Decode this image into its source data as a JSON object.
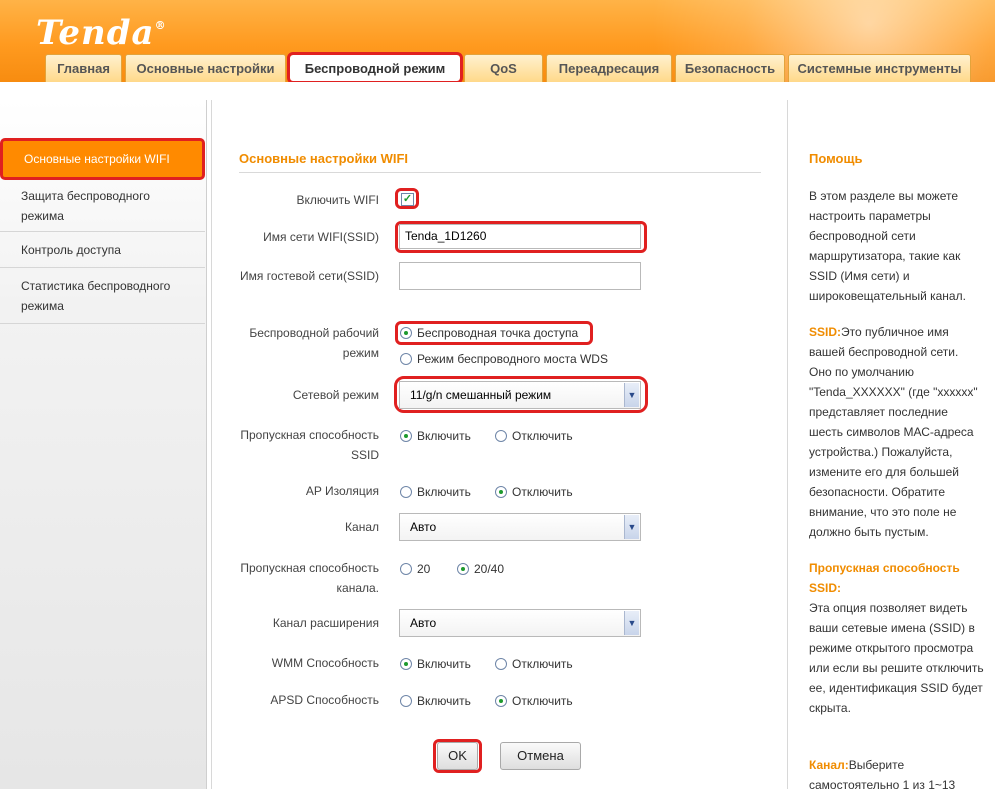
{
  "brand": {
    "logo_text": "Tenda",
    "reg_mark": "®"
  },
  "tabs": [
    {
      "label": "Главная"
    },
    {
      "label": "Основные настройки"
    },
    {
      "label": "Беспроводной режим"
    },
    {
      "label": "QoS"
    },
    {
      "label": "Переадресация"
    },
    {
      "label": "Безопасность"
    },
    {
      "label": "Системные инструменты"
    }
  ],
  "sidebar": {
    "items": [
      {
        "label": "Основные настройки WIFI"
      },
      {
        "label": "Защита беспроводного режима"
      },
      {
        "label": "Контроль доступа"
      },
      {
        "label": "Статистика беспроводного режима"
      }
    ]
  },
  "form": {
    "title": "Основные настройки WIFI",
    "enable_wifi_label": "Включить WIFI",
    "ssid_label": "Имя сети WIFI(SSID)",
    "ssid_value": "Tenda_1D1260",
    "guest_label": "Имя гостевой сети(SSID)",
    "guest_value": "",
    "mode_label": "Беспроводной рабочий режим",
    "mode_option_ap": "Беспроводная точка доступа",
    "mode_option_wds": "Режим беспроводного моста WDS",
    "net_mode_label": "Сетевой режим",
    "net_mode_value": "11/g/n смешанный режим",
    "ssid_broadcast_label": "Пропускная способность SSID",
    "ap_isolation_label": "AP Изоляция",
    "channel_label": "Канал",
    "channel_value": "Авто",
    "bandwidth_label": "Пропускная способность канала.",
    "bw_20": "20",
    "bw_2040": "20/40",
    "ext_channel_label": "Канал расширения",
    "ext_channel_value": "Авто",
    "wmm_label": "WMM Способность",
    "apsd_label": "APSD Способность",
    "on_label": "Включить",
    "off_label": "Отключить",
    "ok_label": "OK",
    "cancel_label": "Отмена"
  },
  "help": {
    "title": "Помощь",
    "intro": "В этом разделе вы можете настроить параметры беспроводной сети маршрутизатора, такие как SSID (Имя сети) и широковещательный канал.",
    "ssid_key": "SSID:",
    "ssid_text": "Это публичное имя вашей беспроводной сети. Оно по умолчанию \"Tenda_XXXXXX\" (где \"xxxxxx\" представляет последние шесть символов МАС-адреса устройства.) Пожалуйста, измените его для большей безопасности. Обратите внимание, что это поле не должно быть пустым.",
    "bcast_key": "Пропускная способность SSID:",
    "bcast_text": "Эта опция позволяет видеть ваши сетевые имена (SSID) в режиме открытого просмотра или если вы решите отключить ее, идентификация SSID будет скрыта.",
    "channel_key": "Канал:",
    "channel_text": "Выберите самостоятельно 1 из 1~13"
  }
}
